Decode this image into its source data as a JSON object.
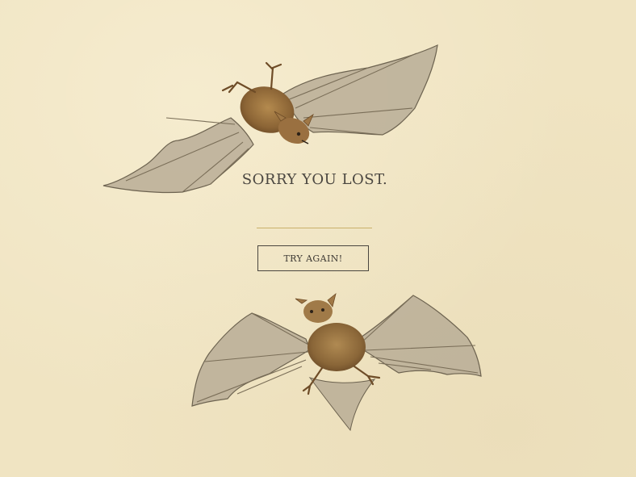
{
  "game": {
    "result_message": "SORRY YOU LOST.",
    "retry_label": "TRY AGAIN!"
  },
  "theme": {
    "background": "#f0e4c2",
    "text": "#4a4640",
    "divider": "#c9b06a",
    "button_border": "#4a463f"
  },
  "illustrations": [
    {
      "name": "bat-illustration-top",
      "icon": "bat-icon"
    },
    {
      "name": "bat-illustration-bottom",
      "icon": "bat-icon"
    }
  ]
}
